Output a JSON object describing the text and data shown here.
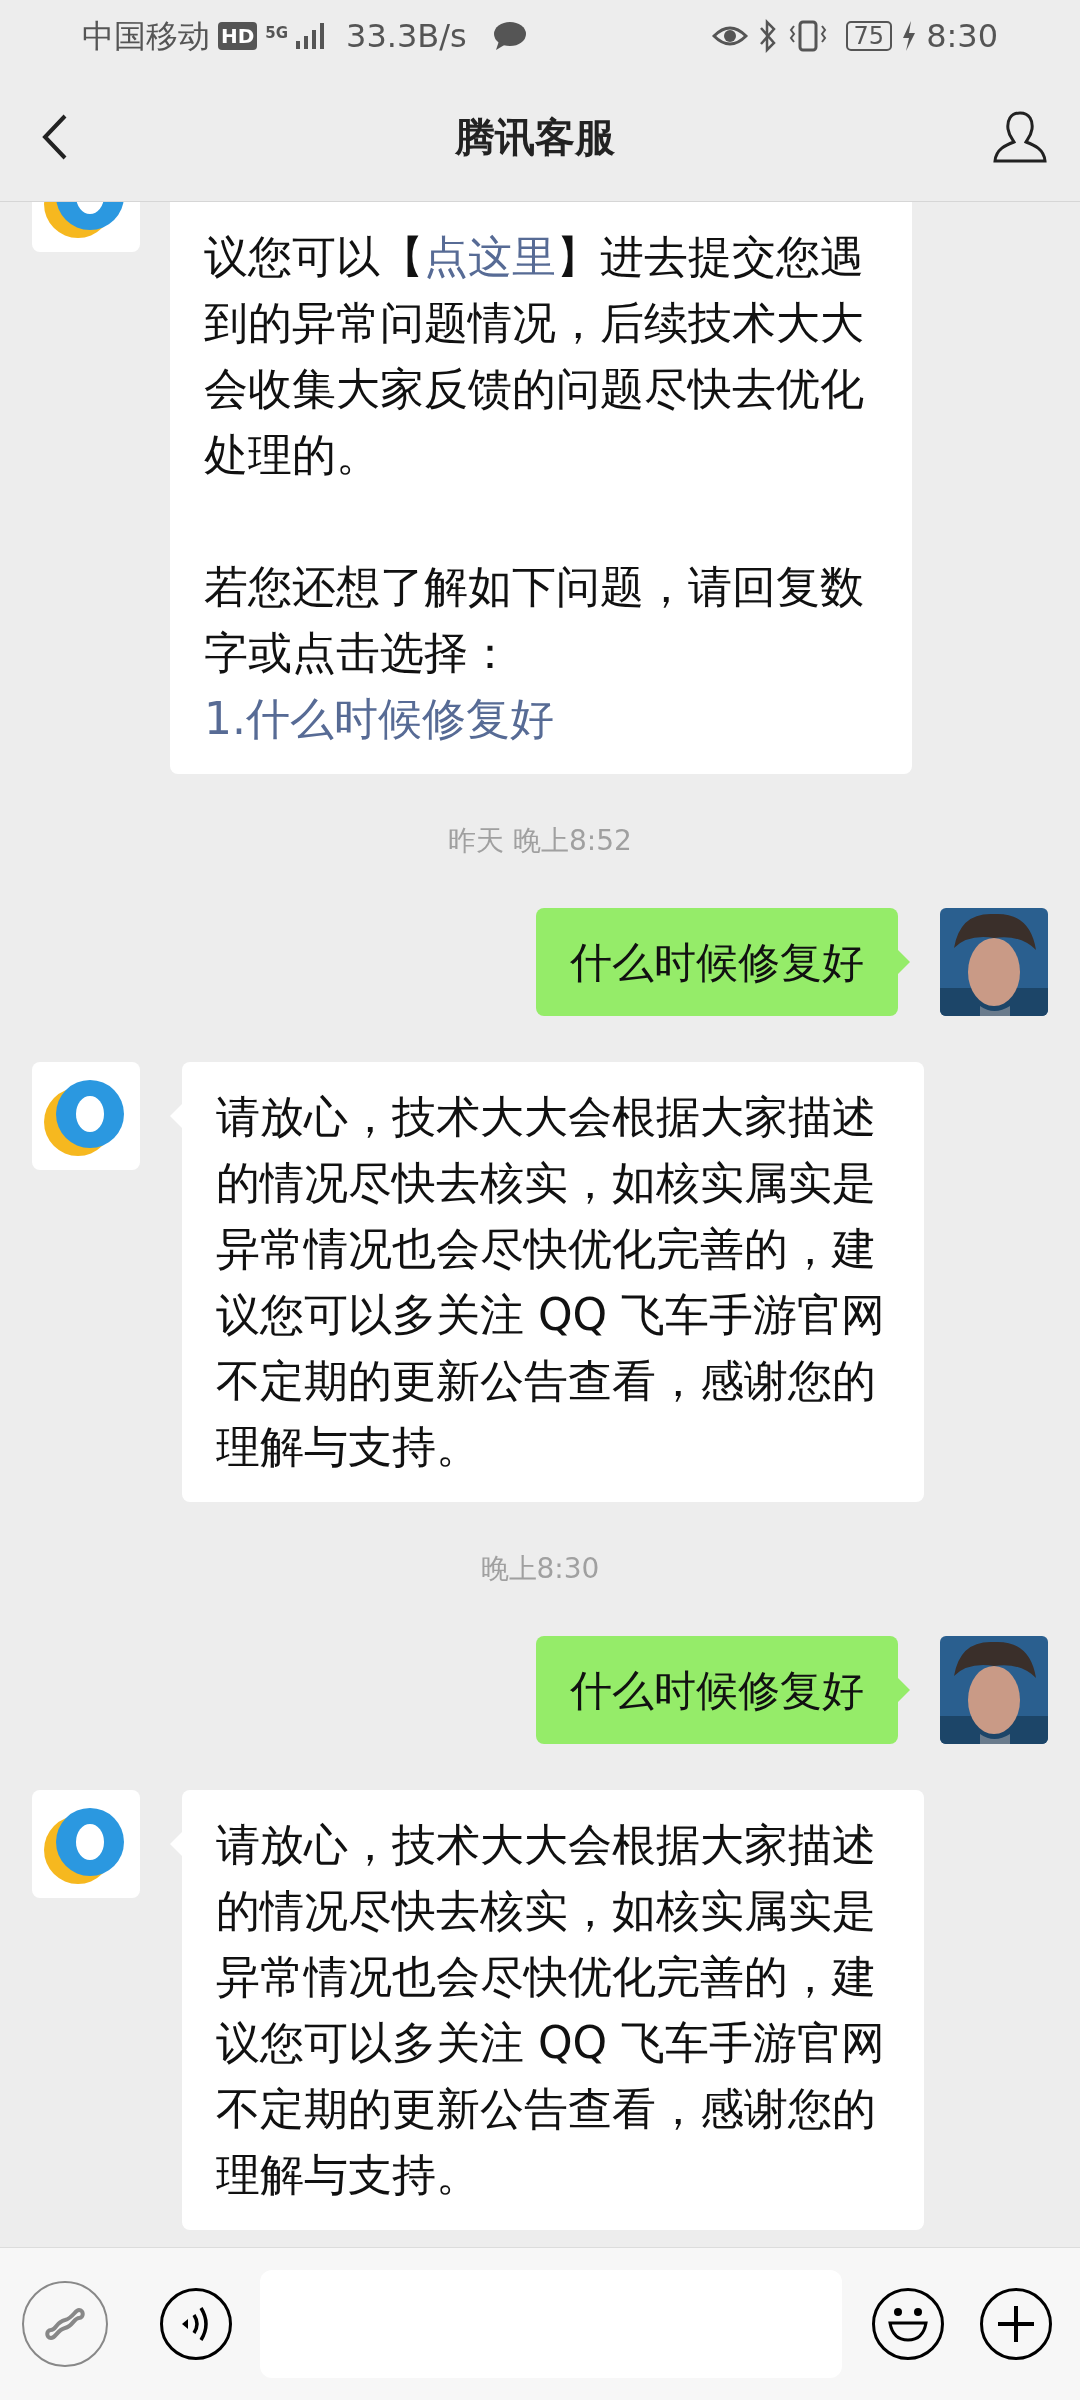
{
  "status_bar": {
    "carrier": "中国移动",
    "hd": "HD",
    "network": "5G",
    "speed": "33.3B/s",
    "battery": "75",
    "time": "8:30"
  },
  "header": {
    "title": "腾讯客服"
  },
  "messages": [
    {
      "kind": "bot",
      "paragraphs": [
        {
          "before": "议您可以【",
          "link": "点这里",
          "after": "】进去提交您遇到的异常问题情况，后续技术大大会收集大家反馈的问题尽快去优化处理的。"
        },
        {
          "before": "若您还想了解如下问题，请回复数字或点击选择："
        }
      ],
      "options": [
        "1.什么时候修复好"
      ]
    },
    {
      "kind": "time",
      "text": "昨天 晚上8:52"
    },
    {
      "kind": "user",
      "text": "什么时候修复好"
    },
    {
      "kind": "bot",
      "paragraphs": [
        {
          "before": "请放心，技术大大会根据大家描述的情况尽快去核实，如核实属实是异常情况也会尽快优化完善的，建议您可以多关注 QQ 飞车手游官网不定期的更新公告查看，感谢您的理解与支持。"
        }
      ]
    },
    {
      "kind": "time",
      "text": "晚上8:30"
    },
    {
      "kind": "user",
      "text": "什么时候修复好"
    },
    {
      "kind": "bot",
      "paragraphs": [
        {
          "before": "请放心，技术大大会根据大家描述的情况尽快去核实，如核实属实是异常情况也会尽快优化完善的，建议您可以多关注 QQ 飞车手游官网不定期的更新公告查看，感谢您的理解与支持。"
        }
      ]
    }
  ]
}
